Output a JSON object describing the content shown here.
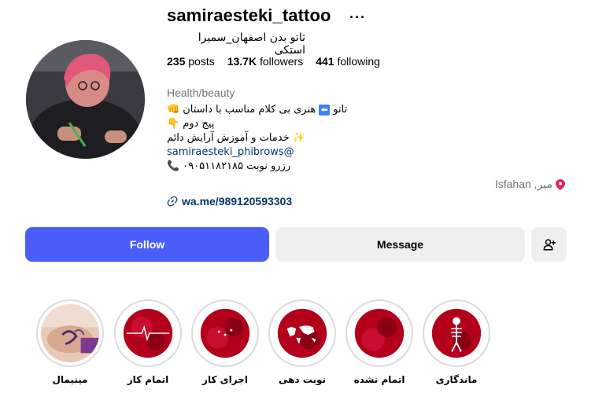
{
  "profile": {
    "username": "samiraesteki_tattoo",
    "more_label": "···",
    "full_name": "تاتو بدن اصفهان_سمیرا استکی",
    "stats": {
      "posts_value": "235",
      "posts_label": "posts",
      "followers_value": "13.7K",
      "followers_label": "followers",
      "following_value": "441",
      "following_label": "following"
    },
    "category": "Health/beauty",
    "bio": {
      "line1_text": "تاتو",
      "line1_arrow": "⬅",
      "line1_rest": "هنری بی کلام مناسب با داستان",
      "line1_emoji": "👊",
      "line2_text": "پیج دوم",
      "line2_emoji": "👇",
      "line3_text": "خدمات و آموزش آرایش دائم",
      "line3_emoji": "✨",
      "line4_link": "samiraesteki_phibrows@",
      "line5_text": "رزرو نوبت ۰۹۰۵۱۱۸۲۱۸۵",
      "line5_emoji": "📞"
    },
    "location": "Isfahan ,میر",
    "website": "wa.me/989120593303"
  },
  "actions": {
    "follow_label": "Follow",
    "message_label": "Message"
  },
  "highlights": [
    {
      "label": "مینیمال",
      "icon": "tattoo-photo"
    },
    {
      "label": "اتمام کار",
      "icon": "heartbeat"
    },
    {
      "label": "اجرای کار",
      "icon": "sparkles"
    },
    {
      "label": "نوبت دهی",
      "icon": "world-map"
    },
    {
      "label": "اتمام نشده",
      "icon": "red-splash"
    },
    {
      "label": "ماندگاری",
      "icon": "skeleton"
    }
  ],
  "colors": {
    "follow_button": "#4a5df9",
    "secondary_button": "#efefef",
    "link": "#00376b",
    "muted_text": "#737373",
    "highlight_red": "#b3001b"
  }
}
